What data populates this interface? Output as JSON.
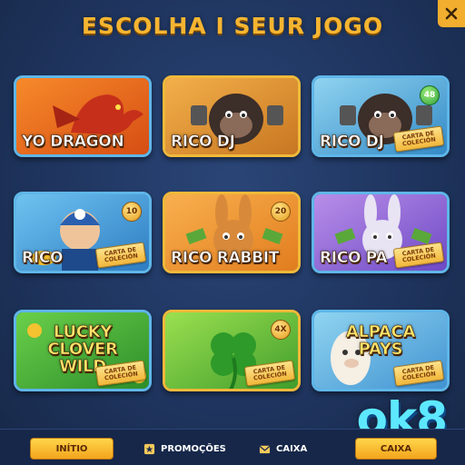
{
  "header": {
    "title": "ESCOLHA I SEUR JOGO"
  },
  "close": {
    "icon": "close-icon"
  },
  "card_label": "CARTA DE\nCOLECIÓN",
  "games": [
    {
      "name": "YO DRAGON",
      "art": "dragon",
      "colors": [
        "#f78a2a",
        "#d44a12"
      ],
      "frame": "blue"
    },
    {
      "name": "RICO DJ",
      "art": "gorilla-dj",
      "colors": [
        "#f3b04a",
        "#c5731f"
      ],
      "frame": "gold"
    },
    {
      "name": "RICO DJ",
      "art": "gorilla-dj-blue",
      "colors": [
        "#8fd3f0",
        "#2e86c4"
      ],
      "frame": "blue",
      "badge": "48",
      "card": true
    },
    {
      "name": "RICO",
      "art": "rico-miner",
      "colors": [
        "#6ec3f0",
        "#2a78c0"
      ],
      "frame": "blue",
      "badge": "10",
      "card": true
    },
    {
      "name": "RICO RABBIT",
      "art": "rabbit",
      "colors": [
        "#f9b04e",
        "#e07a1c"
      ],
      "frame": "gold",
      "badge": "20"
    },
    {
      "name": "RICO PA",
      "art": "rabbit-purple",
      "colors": [
        "#b88ee8",
        "#6a46c4"
      ],
      "frame": "blue",
      "card": true
    },
    {
      "name": "LUCKY\nCLOVER\nWILD",
      "art": "clover-wild",
      "colors": [
        "#6ad04a",
        "#2a8a28"
      ],
      "frame": "blue",
      "card": true,
      "big": true
    },
    {
      "name": "",
      "art": "clover",
      "colors": [
        "#9be050",
        "#3c9a2a"
      ],
      "frame": "gold",
      "badge": "4X",
      "card": true
    },
    {
      "name": "ALPACA\nPAYS",
      "art": "alpaca",
      "colors": [
        "#8fd4f0",
        "#3d8fd0"
      ],
      "frame": "blue",
      "card": true,
      "big": true
    }
  ],
  "nav": {
    "inicio": "INÍTIO",
    "promocoes": "PROMOÇÕES",
    "caixa": "CAIXA",
    "caixa_button": "CAIXA"
  },
  "watermark": "ok8"
}
